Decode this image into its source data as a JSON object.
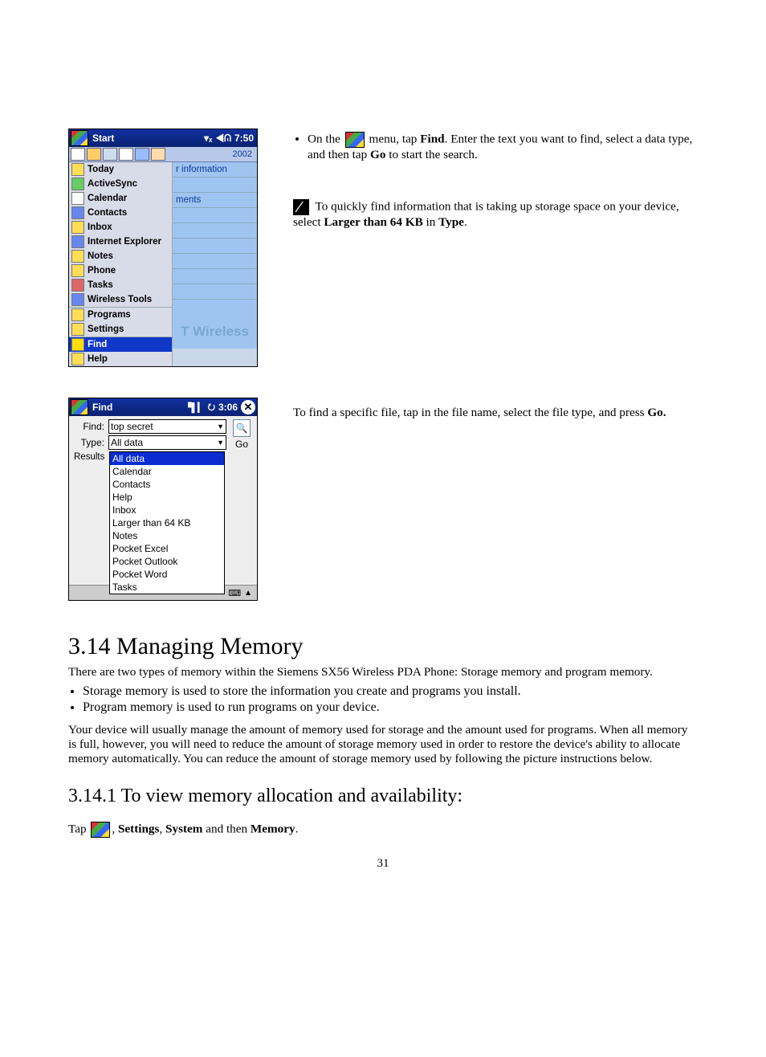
{
  "page_number": "31",
  "start_shot": {
    "title": "Start",
    "time": "7:50",
    "bg_year": "2002",
    "bg_hint": "r information",
    "bg_hint2": "ments",
    "menu": [
      "Today",
      "ActiveSync",
      "Calendar",
      "Contacts",
      "Inbox",
      "Internet Explorer",
      "Notes",
      "Phone",
      "Tasks",
      "Wireless Tools"
    ],
    "menu2": [
      "Programs",
      "Settings"
    ],
    "menu3": [
      "Find",
      "Help"
    ],
    "brand": "T Wireless"
  },
  "find_shot": {
    "title": "Find",
    "time": "3:06",
    "find_label": "Find:",
    "type_label": "Type:",
    "results_label": "Results",
    "find_value": "top secret",
    "type_value": "All data",
    "go_label": "Go",
    "options": [
      "All data",
      "Calendar",
      "Contacts",
      "Help",
      "Inbox",
      "Larger than 64 KB",
      "Notes",
      "Pocket Excel",
      "Pocket Outlook",
      "Pocket Word",
      "Tasks"
    ]
  },
  "right1": {
    "bullet_pre": "On the ",
    "bullet_mid1": " menu, tap ",
    "bullet_b1": "Find",
    "bullet_mid2": ". Enter the text you want to find, select a data type, and then tap ",
    "bullet_b2": "Go",
    "bullet_end": " to start the search.",
    "note_pre": " To quickly find information that is taking up storage space on your device, select ",
    "note_b1": "Larger than 64 KB",
    "note_mid": " in ",
    "note_b2": "Type",
    "note_end": "."
  },
  "right2": "To find a specific file, tap in the file name, select the file type, and press ",
  "right2_b": "Go.",
  "section_title": "3.14 Managing Memory",
  "section_intro": "There are two types of memory within the Siemens SX56 Wireless PDA Phone: Storage memory and program memory.",
  "section_bullets": [
    "Storage memory is used to store the information you create and programs you install.",
    "Program memory is used to run programs on your device."
  ],
  "section_para": "Your device will usually manage the amount of memory used for storage and the amount used for programs.  When all memory is full, however, you will need to reduce the amount of storage memory used in order to restore the device's ability to allocate memory automatically.  You can reduce the amount of storage memory used by following the picture instructions below.",
  "subsection_title": "3.14.1  To view memory allocation and availability:",
  "sub_text": {
    "pre": "Tap ",
    "mid1": ", ",
    "b1": "Settings",
    "mid2": ", ",
    "b2": "System",
    "mid3": " and then ",
    "b3": "Memory",
    "end": "."
  }
}
